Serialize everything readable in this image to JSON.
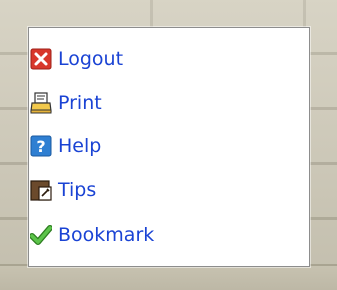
{
  "menu": {
    "items": [
      {
        "label": "Logout",
        "icon": "logout-icon"
      },
      {
        "label": "Print",
        "icon": "printer-icon"
      },
      {
        "label": "Help",
        "icon": "help-icon"
      },
      {
        "label": "Tips",
        "icon": "tips-icon"
      },
      {
        "label": "Bookmark",
        "icon": "bookmark-check-icon"
      }
    ]
  },
  "colors": {
    "link": "#1a43d4",
    "logout_icon": "#d8382c",
    "help_icon": "#2f7fd2",
    "bookmark_icon": "#3f9f2e"
  }
}
